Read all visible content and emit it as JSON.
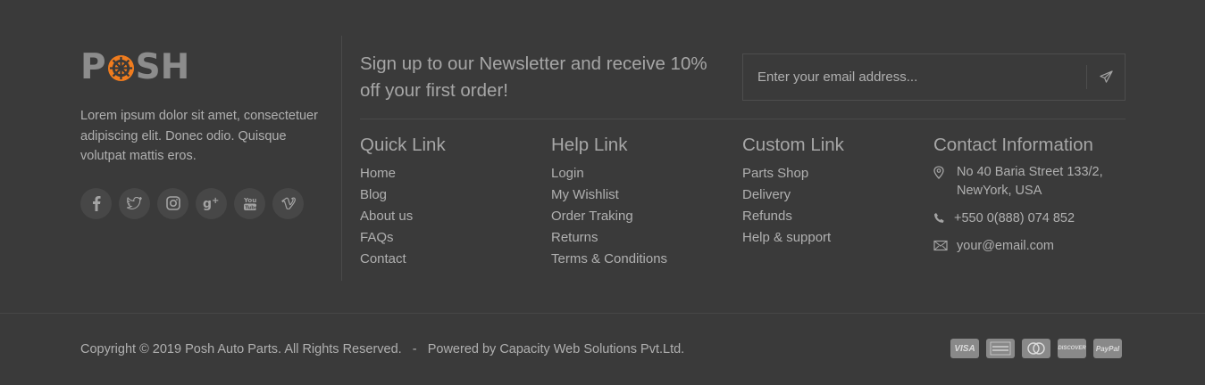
{
  "brand": {
    "logo_text_left": "P",
    "logo_text_right": "SH",
    "accent_color": "#f07c1e",
    "about": "Lorem ipsum dolor sit amet, consectetuer adipiscing elit. Donec odio. Quisque volutpat mattis eros."
  },
  "social": [
    {
      "name": "facebook-icon",
      "glyph": "f"
    },
    {
      "name": "twitter-icon",
      "glyph": "t"
    },
    {
      "name": "instagram-icon",
      "glyph": "ig"
    },
    {
      "name": "google-plus-icon",
      "glyph": "g+"
    },
    {
      "name": "youtube-icon",
      "glyph": "yt"
    },
    {
      "name": "vimeo-icon",
      "glyph": "v"
    }
  ],
  "newsletter": {
    "title": "Sign up to our Newsletter and receive 10% off your first order!",
    "placeholder": "Enter your email address...",
    "send_icon": "paper-plane-icon"
  },
  "quick_link": {
    "title": "Quick Link",
    "items": [
      "Home",
      "Blog",
      "About us",
      "FAQs",
      "Contact"
    ]
  },
  "help_link": {
    "title": "Help Link",
    "items": [
      "Login",
      "My Wishlist",
      "Order Traking",
      "Returns",
      "Terms & Conditions"
    ]
  },
  "custom_link": {
    "title": "Custom Link",
    "items": [
      "Parts Shop",
      "Delivery",
      "Refunds",
      "Help & support"
    ]
  },
  "contact": {
    "title": "Contact Information",
    "address_line1": "No 40 Baria Street 133/2,",
    "address_line2": "NewYork, USA",
    "phone": "+550 0(888) 074 852",
    "email": "your@email.com"
  },
  "footer_bottom": {
    "copyright": "Copyright © 2019 Posh Auto Parts. All Rights Reserved.",
    "separator": "-",
    "powered": "Powered by Capacity Web Solutions Pvt.Ltd.",
    "payments": [
      "VISA",
      "AMERICAN EXPRESS",
      "MasterCard",
      "DISCOVER",
      "PayPal"
    ]
  }
}
